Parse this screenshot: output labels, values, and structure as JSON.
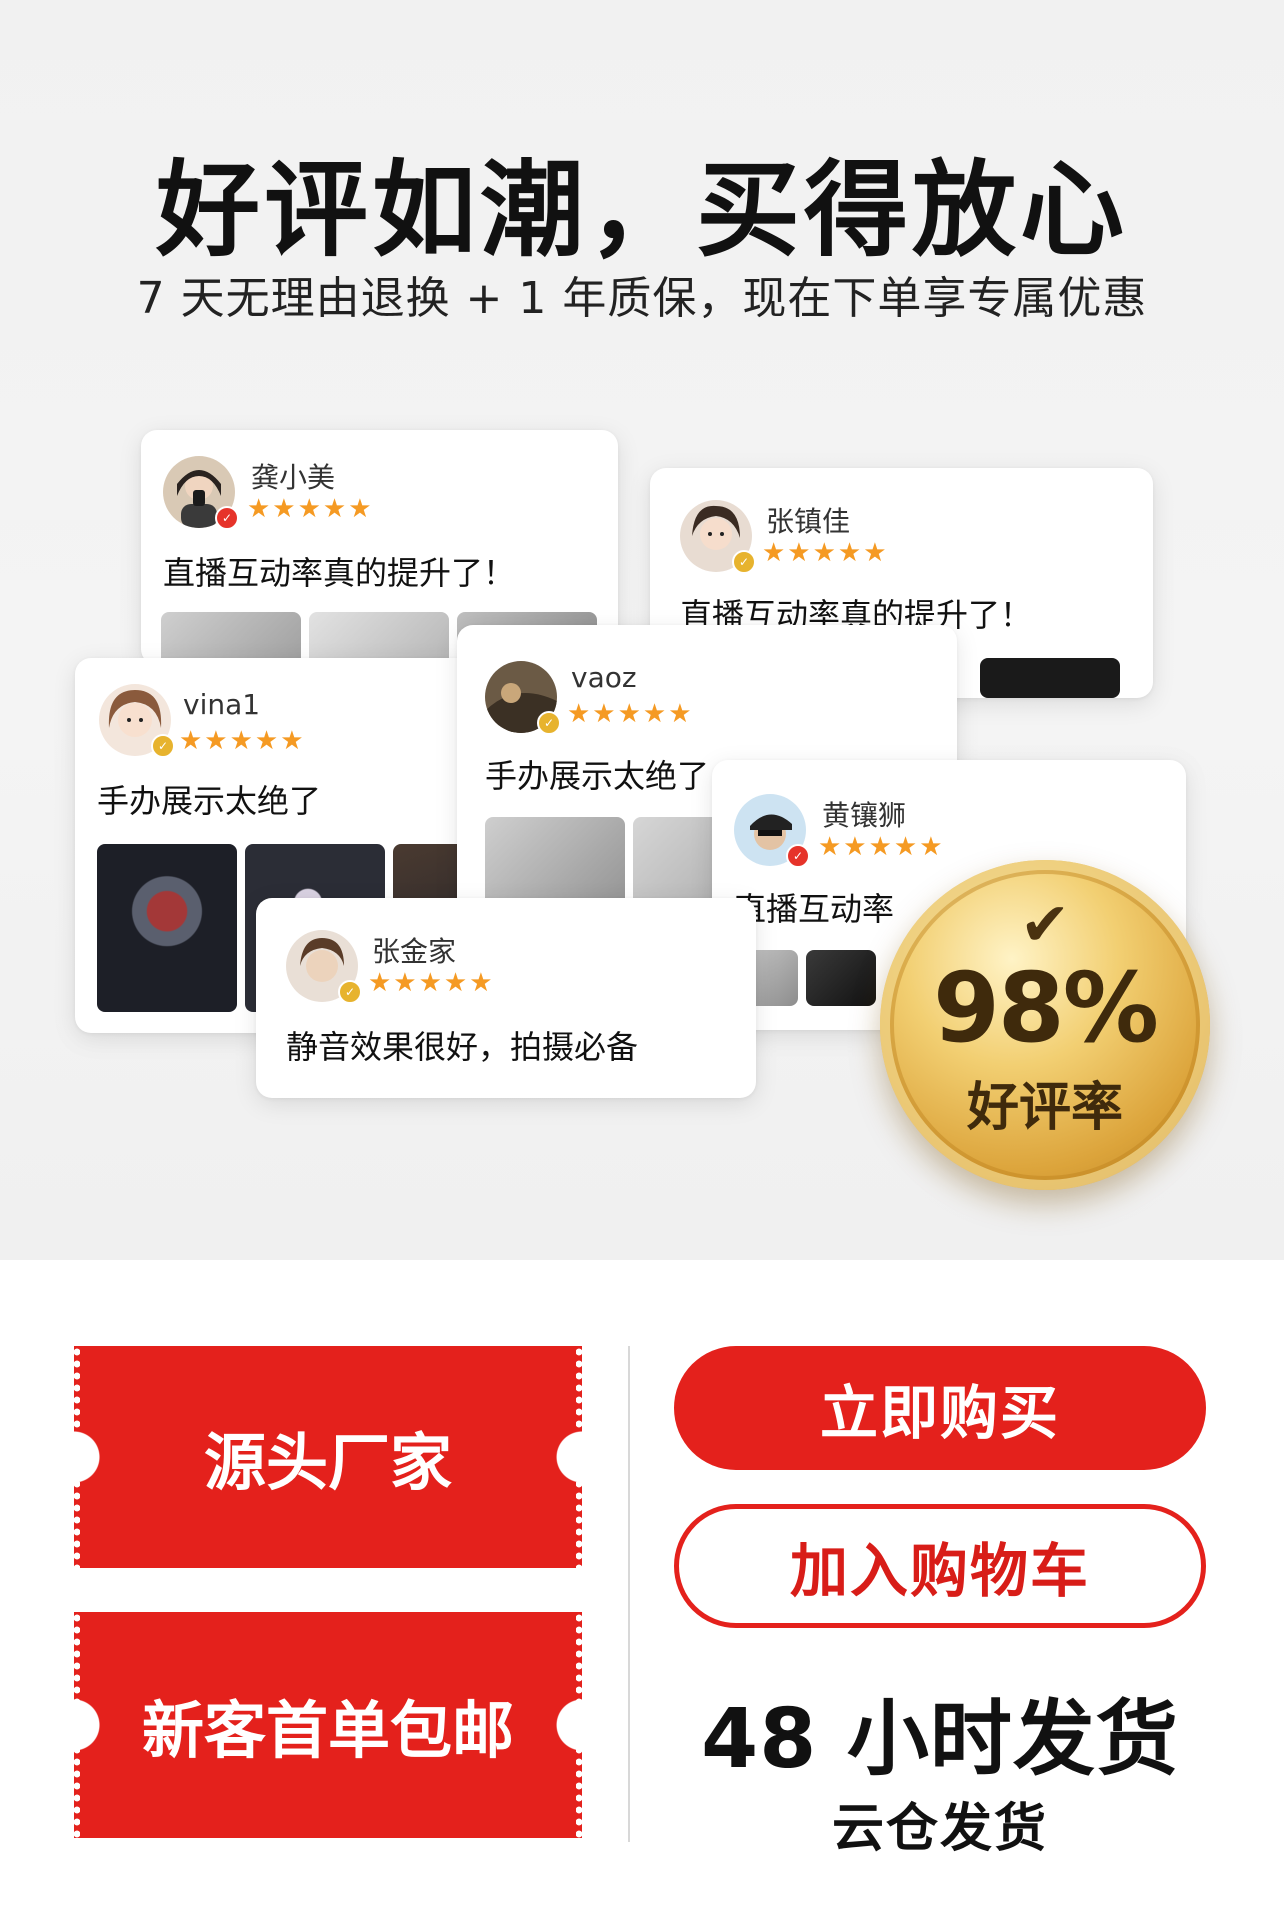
{
  "headline": "好评如潮，买得放心",
  "subline": "7 天无理由退换 + 1 年质保，现在下单享专属优惠",
  "star_glyphs": "★★★★★",
  "reviews": [
    {
      "user": "龚小美",
      "text": "直播互动率真的提升了！",
      "rating": 5,
      "badge": "red"
    },
    {
      "user": "张镇佳",
      "text": "直播互动率真的提升了！",
      "rating": 5,
      "badge": "gold"
    },
    {
      "user": "vina1",
      "text": "手办展示太绝了",
      "rating": 5,
      "badge": "gold"
    },
    {
      "user": "vaoz",
      "text": "手办展示太绝了",
      "rating": 5,
      "badge": "gold"
    },
    {
      "user": "黄镶狮",
      "text": "直播互动率",
      "rating": 5,
      "badge": "red"
    },
    {
      "user": "张金家",
      "text": "静音效果很好，拍摄必备",
      "rating": 5,
      "badge": "gold"
    }
  ],
  "medal": {
    "check": "✔",
    "percent": "98%",
    "label": "好评率"
  },
  "tickets": [
    "源头厂家",
    "新客首单包邮"
  ],
  "actions": {
    "buy_label": "立即购买",
    "cart_label": "加入购物车"
  },
  "shipping": {
    "headline": "48 小时发货",
    "sub": "云仓发货"
  },
  "colors": {
    "accent_red": "#e4211c",
    "star_orange": "#f59a23",
    "medal_gold": "#dca43b"
  }
}
